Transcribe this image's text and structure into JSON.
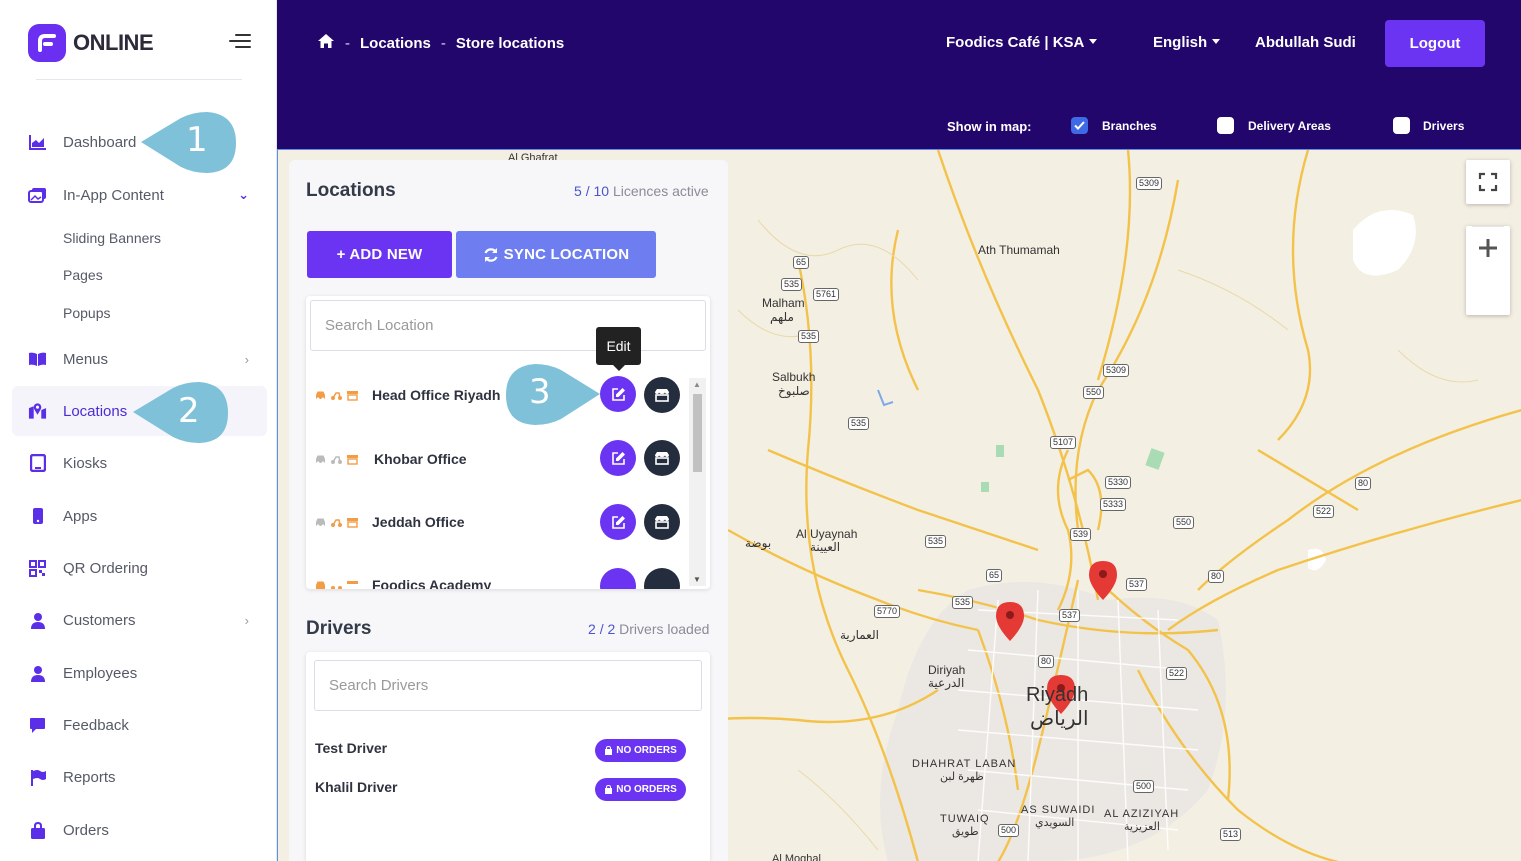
{
  "brand": {
    "name": "ONLINE"
  },
  "sidebar": {
    "items": [
      {
        "label": "Dashboard"
      },
      {
        "label": "In-App Content"
      },
      {
        "label": "Menus"
      },
      {
        "label": "Locations"
      },
      {
        "label": "Kiosks"
      },
      {
        "label": "Apps"
      },
      {
        "label": "QR Ordering"
      },
      {
        "label": "Customers"
      },
      {
        "label": "Employees"
      },
      {
        "label": "Feedback"
      },
      {
        "label": "Reports"
      },
      {
        "label": "Orders"
      }
    ],
    "sub_items": [
      "Sliding Banners",
      "Pages",
      "Popups"
    ]
  },
  "header": {
    "breadcrumb": [
      "Locations",
      "Store locations"
    ],
    "breadcrumb_sep": "-",
    "business": "Foodics Café | KSA",
    "language": "English",
    "user": "Abdullah Sudi",
    "logout": "Logout",
    "show_in_map": "Show in map:",
    "toggles": [
      {
        "label": "Branches",
        "checked": true
      },
      {
        "label": "Delivery Areas",
        "checked": false
      },
      {
        "label": "Drivers",
        "checked": false
      }
    ]
  },
  "locations": {
    "title": "Locations",
    "active": "5",
    "total": "10",
    "count_suffix": "Licences active",
    "add_new": "+ ADD NEW",
    "sync": "SYNC LOCATION",
    "search_placeholder": "Search Location",
    "items": [
      {
        "name": "Head Office Riyadh"
      },
      {
        "name": "Khobar Office"
      },
      {
        "name": "Jeddah Office"
      },
      {
        "name": "Foodics Academy"
      }
    ],
    "tooltip": "Edit"
  },
  "drivers": {
    "title": "Drivers",
    "loaded": "2",
    "total": "2",
    "count_suffix": "Drivers loaded",
    "search_placeholder": "Search Drivers",
    "items": [
      {
        "name": "Test Driver",
        "status": "NO ORDERS"
      },
      {
        "name": "Khalil Driver",
        "status": "NO ORDERS"
      }
    ]
  },
  "map": {
    "places": [
      "Ath Thumamah",
      "Malham",
      "ملهم",
      "Salbukh",
      "صلبوخ",
      "Al Uyaynah",
      "العيينة",
      "بوضة",
      "العمارية",
      "Diriyah",
      "الدرعية",
      "Riyadh",
      "الرياض",
      "DHAHRAT LABAN",
      "ظهرة لبن",
      "AS SUWAIDI",
      "السويدي",
      "AL AZIZIYAH",
      "العزيزية",
      "TUWAIQ",
      "طويق",
      "Al Ghafrat",
      "Al Moghal"
    ],
    "shields": [
      "5309",
      "65",
      "535",
      "5761",
      "535",
      "5309",
      "550",
      "535",
      "5107",
      "5330",
      "5333",
      "80",
      "522",
      "550",
      "539",
      "535",
      "65",
      "537",
      "80",
      "5770",
      "535",
      "537",
      "80",
      "522",
      "500",
      "500",
      "513"
    ]
  },
  "callouts": [
    "1",
    "2",
    "3"
  ],
  "colors": {
    "header": "#23066b",
    "accent": "#6b34f2",
    "pin": "#e53935"
  }
}
